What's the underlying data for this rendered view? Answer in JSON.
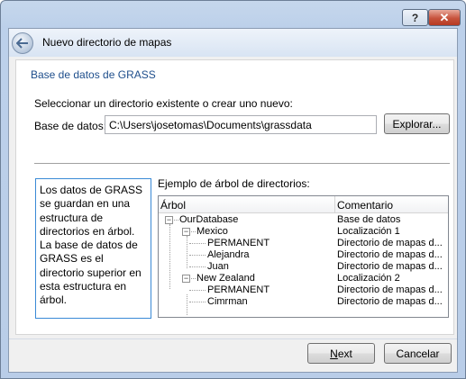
{
  "window": {
    "help_glyph": "?",
    "close_glyph": "✕",
    "wizard_title": "Nuevo directorio de mapas"
  },
  "page": {
    "section_title": "Base de datos de GRASS",
    "instruction": "Seleccionar un directorio existente o crear uno nuevo:",
    "db_label": "Base de datos:",
    "db_value": "C:\\Users\\josetomas\\Documents\\grassdata",
    "browse_label": "Explorar...",
    "info_text": "Los datos de GRASS se guardan en una estructura de directorios en árbol. La base de datos de GRASS es el directorio superior en esta estructura en árbol.",
    "tree_caption": "Ejemplo de árbol de directorios:",
    "tree_headers": [
      "Árbol",
      "Comentario"
    ],
    "tree_rows": [
      {
        "name": "OurDatabase",
        "comment": "Base de datos",
        "level": 0,
        "expander": "−"
      },
      {
        "name": "Mexico",
        "comment": "Localización 1",
        "level": 1,
        "expander": "−"
      },
      {
        "name": "PERMANENT",
        "comment": "Directorio de mapas d...",
        "level": 2,
        "expander": ""
      },
      {
        "name": "Alejandra",
        "comment": "Directorio de mapas d...",
        "level": 2,
        "expander": ""
      },
      {
        "name": "Juan",
        "comment": "Directorio de mapas d...",
        "level": 2,
        "expander": ""
      },
      {
        "name": "New Zealand",
        "comment": "Localización 2",
        "level": 1,
        "expander": "−"
      },
      {
        "name": "PERMANENT",
        "comment": "Directorio de mapas d...",
        "level": 2,
        "expander": ""
      },
      {
        "name": "Cimrman",
        "comment": "Directorio de mapas d...",
        "level": 2,
        "expander": ""
      }
    ]
  },
  "footer": {
    "next_label_mnemonic": "N",
    "next_label_rest": "ext",
    "cancel_label": "Cancelar"
  },
  "icons": {
    "back": "back-arrow-icon",
    "expander": "tree-collapse-icon"
  },
  "colors": {
    "section_title": "#1e4e8c",
    "info_border": "#3a8ad6",
    "close_button": "#c7533c"
  }
}
